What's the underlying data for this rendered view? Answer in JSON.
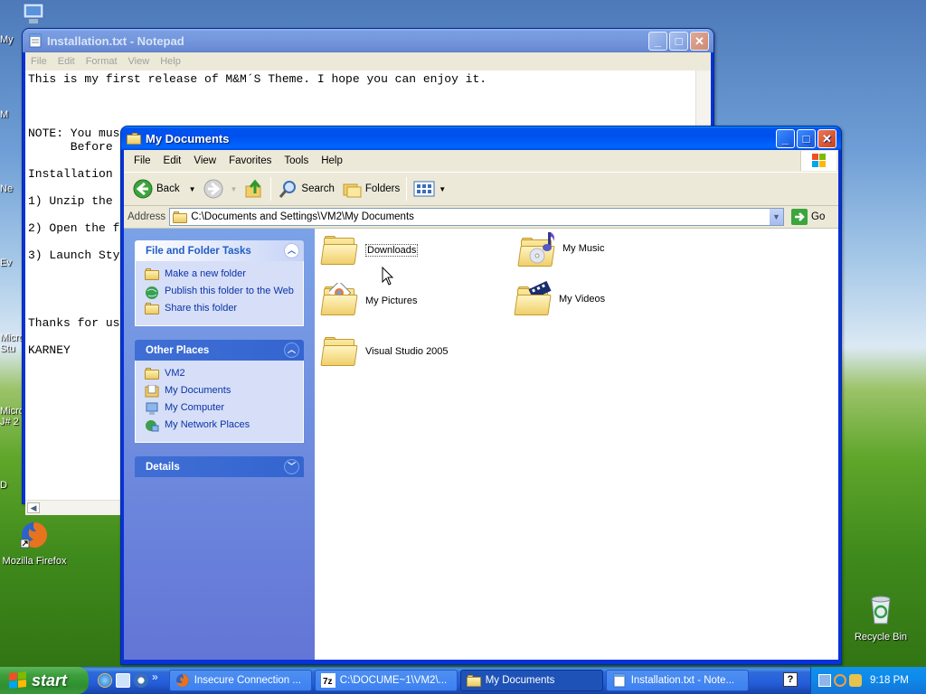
{
  "desktop": {
    "icons": [
      {
        "label": "Mozilla Firefox"
      },
      {
        "label": "Recycle Bin"
      }
    ],
    "edge_labels": [
      "My",
      "M",
      "Ne",
      "Ev",
      "Micro",
      "Stu",
      "Micro",
      "J# 2",
      "D"
    ]
  },
  "notepad": {
    "title": "Installation.txt - Notepad",
    "menu": [
      "File",
      "Edit",
      "Format",
      "View",
      "Help"
    ],
    "lines": [
      "This is my first release of M&M´S Theme. I hope you can enjoy it.",
      "",
      "",
      "",
      "NOTE: You mus",
      "      Before",
      "",
      "Installation",
      "",
      "1) Unzip the",
      "",
      "2) Open the f",
      "",
      "3) Launch Sty",
      "",
      "",
      "",
      "",
      "Thanks for us",
      "",
      "KARNEY"
    ]
  },
  "explorer": {
    "title": "My Documents",
    "menu": [
      "File",
      "Edit",
      "View",
      "Favorites",
      "Tools",
      "Help"
    ],
    "toolbar": {
      "back": "Back",
      "search": "Search",
      "folders": "Folders"
    },
    "address": {
      "label": "Address",
      "value": "C:\\Documents and Settings\\VM2\\My Documents",
      "go": "Go"
    },
    "tasks": {
      "file_folder": {
        "title": "File and Folder Tasks",
        "items": [
          "Make a new folder",
          "Publish this folder to the Web",
          "Share this folder"
        ]
      },
      "other_places": {
        "title": "Other Places",
        "items": [
          "VM2",
          "My Documents",
          "My Computer",
          "My Network Places"
        ]
      },
      "details": {
        "title": "Details"
      }
    },
    "items": [
      "Downloads",
      "My Music",
      "My Pictures",
      "My Videos",
      "Visual Studio 2005"
    ]
  },
  "taskbar": {
    "start": "start",
    "tasks": [
      "Insecure Connection ...",
      "C:\\DOCUME~1\\VM2\\...",
      "My Documents",
      "Installation.txt - Note..."
    ],
    "active_task": "My Documents",
    "chevron": "»",
    "help": "?",
    "clock": "9:18 PM"
  }
}
